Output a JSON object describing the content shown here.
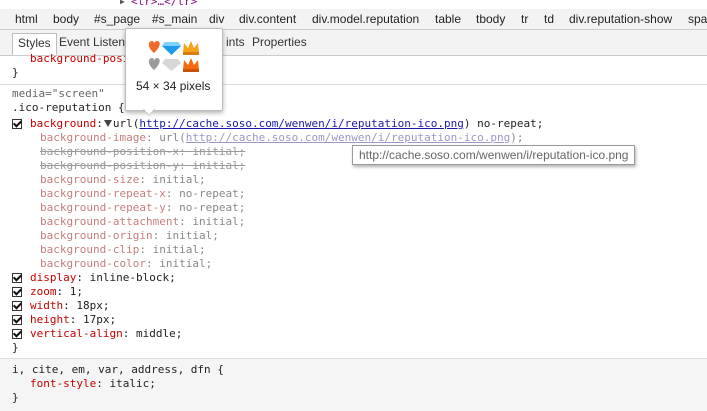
{
  "dom_row": {
    "text": "<tr>…</tr>"
  },
  "breadcrumbs": [
    "html",
    "body",
    "#s_page",
    "#s_main",
    "div",
    "div.content",
    "div.model.reputation",
    "table",
    "tbody",
    "tr",
    "td",
    "div.reputation-show",
    "spa"
  ],
  "tabs": {
    "styles": "Styles",
    "event_listeners": "Event Listene",
    "dom_breakpoints_tail": "ints",
    "properties": "Properties"
  },
  "image_preview": {
    "dimensions": "54 × 34 pixels"
  },
  "tooltip": {
    "url": "http://cache.soso.com/wenwen/i/reputation-ico.png"
  },
  "styles": {
    "prev_tail": {
      "prop": "background-posi",
      "close": "}"
    },
    "media": "media=\"screen\"",
    "selector": ".ico-reputation {",
    "background": {
      "prop": "background",
      "value_prefix": "url(",
      "url": "http://cache.soso.com/wenwen/i/reputation-ico.png",
      "value_suffix": ") no-repeat;"
    },
    "longhands": [
      {
        "prop": "background-image",
        "value": "url(http://cache.soso.com/wenwen/i/reputation-ico.png);",
        "struck": false,
        "link": true
      },
      {
        "prop": "background-position-x",
        "value": "initial;",
        "struck": true
      },
      {
        "prop": "background-position-y",
        "value": "initial;",
        "struck": true
      },
      {
        "prop": "background-size",
        "value": "initial;",
        "struck": false
      },
      {
        "prop": "background-repeat-x",
        "value": "no-repeat;",
        "struck": false
      },
      {
        "prop": "background-repeat-y",
        "value": "no-repeat;",
        "struck": false
      },
      {
        "prop": "background-attachment",
        "value": "initial;",
        "struck": false
      },
      {
        "prop": "background-origin",
        "value": "initial;",
        "struck": false
      },
      {
        "prop": "background-clip",
        "value": "initial;",
        "struck": false
      },
      {
        "prop": "background-color",
        "value": "initial;",
        "struck": false
      }
    ],
    "declarations": [
      {
        "prop": "display",
        "value": "inline-block;"
      },
      {
        "prop": "zoom",
        "value": "1;"
      },
      {
        "prop": "width",
        "value": "18px;"
      },
      {
        "prop": "height",
        "value": "17px;"
      },
      {
        "prop": "vertical-align",
        "value": "middle;"
      }
    ],
    "close": "}",
    "rule2": {
      "selector": "i, cite, em, var, address, dfn {",
      "prop": "font-style",
      "value": "italic;",
      "close": "}"
    }
  }
}
